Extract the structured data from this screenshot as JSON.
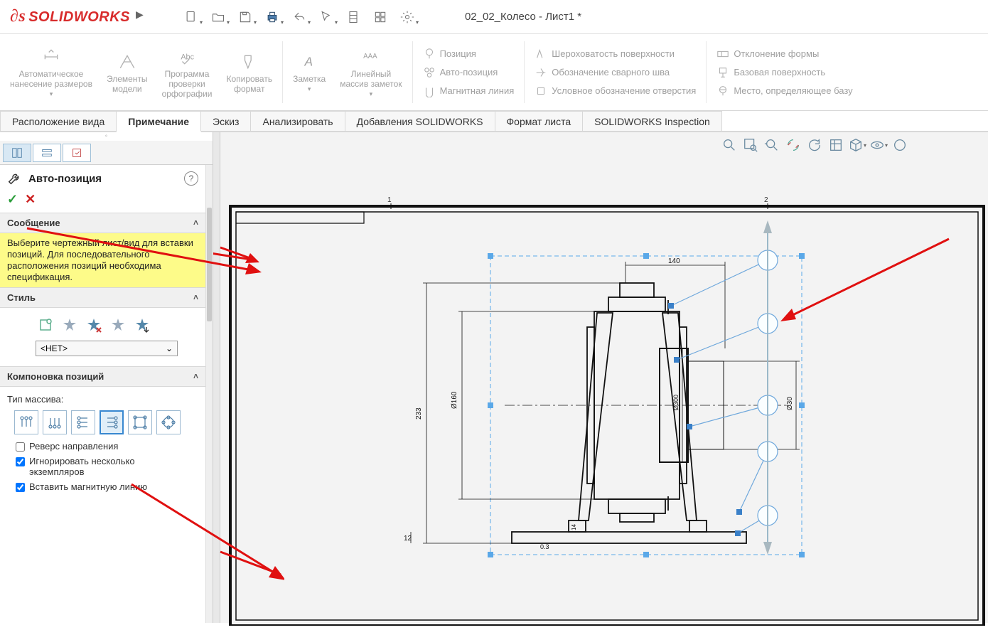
{
  "app": {
    "logo": "SOLIDWORKS",
    "doc_title": "02_02_Колесо - Лист1 *"
  },
  "ribbon": {
    "auto_dim": "Автоматическое\nнанесение размеров",
    "model_items": "Элементы\nмодели",
    "spellcheck": "Программа\nпроверки\nорфографии",
    "format_painter": "Копировать\nформат",
    "note": "Заметка",
    "linear_note": "Линейный\nмассив заметок",
    "balloon": "Позиция",
    "auto_balloon": "Авто-позиция",
    "magnetic_line": "Магнитная линия",
    "surface_finish": "Шероховатость поверхности",
    "weld_symbol": "Обозначение сварного шва",
    "hole_callout": "Условное обозначение отверстия",
    "geom_tol": "Отклонение формы",
    "datum": "Базовая поверхность",
    "datum_target": "Место, определяющее базу"
  },
  "tabs": {
    "t1": "Расположение вида",
    "t2": "Примечание",
    "t3": "Эскиз",
    "t4": "Анализировать",
    "t5": "Добавления SOLIDWORKS",
    "t6": "Формат листа",
    "t7": "SOLIDWORKS Inspection"
  },
  "panel": {
    "title": "Авто-позиция",
    "section_msg": "Сообщение",
    "msg_text": "Выберите чертежный лист/вид для вставки позиций. Для последовательного расположения позиций необходима спецификация.",
    "section_style": "Стиль",
    "style_value": "<НЕТ>",
    "section_layout": "Компоновка позиций",
    "array_type": "Тип массива:",
    "cb_reverse": "Реверс направления",
    "cb_ignore": "Игнорировать несколько экземпляров",
    "cb_magnet": "Вставить магнитную линию"
  },
  "drawing": {
    "dims": {
      "d140": "140",
      "d160": "Ø160",
      "d300": "Ø300",
      "d30": "Ø30",
      "h233": "233",
      "h12": "12",
      "g14": "14",
      "g03": "0.3"
    }
  }
}
